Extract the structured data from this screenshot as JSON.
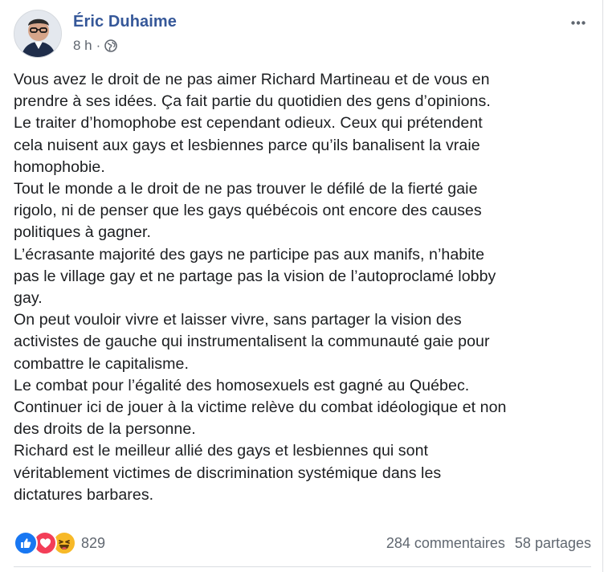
{
  "post": {
    "author": "Éric Duhaime",
    "time": "8 h",
    "separator": "·",
    "privacy_icon": "globe-icon",
    "more_icon": "more-options-icon",
    "paragraphs": [
      "Vous avez le droit de ne pas aimer Richard Martineau et de vous en prendre à ses idées. Ça fait partie du quotidien des gens d’opinions.",
      "Le traiter d’homophobe est cependant odieux. Ceux qui prétendent cela nuisent aux gays et lesbiennes parce qu’ils banalisent la vraie homophobie.",
      "Tout le monde a le droit de ne pas trouver le défilé de la fierté gaie rigolo, ni de penser que les gays québécois ont encore des causes politiques à gagner.",
      "L’écrasante majorité des gays ne participe pas aux manifs, n’habite pas le village gay et ne partage pas la vision de l’autoproclamé lobby gay.",
      "On peut vouloir vivre et laisser vivre, sans partager la vision des activistes de gauche qui instrumentalisent la communauté gaie pour combattre le capitalisme.",
      "Le combat pour l’égalité des homosexuels est gagné au Québec.",
      "Continuer ici de jouer à la victime relève du combat idéologique et non des droits de la personne.",
      "Richard est le meilleur allié des gays et lesbiennes qui sont véritablement victimes de discrimination systémique dans les dictatures barbares."
    ],
    "line_breaks": [
      "Vous avez le droit de ne pas aimer Richard Martineau et de vous en\nprendre à ses idées. Ça fait partie du quotidien des gens d’opinions.",
      "Le traiter d’homophobe est cependant odieux. Ceux qui prétendent\ncela nuisent aux gays et lesbiennes parce qu’ils banalisent la vraie\nhomophobie.",
      "Tout le monde a le droit de ne pas trouver le défilé de la fierté gaie\nrigolo, ni de penser que les gays québécois ont encore des causes\npolitiques à gagner.",
      "L’écrasante majorité des gays ne participe pas aux manifs, n’habite\npas le village gay et ne partage pas la vision de l’autoproclamé lobby\ngay.",
      "On peut vouloir vivre et laisser vivre, sans partager la vision des\nactivistes de gauche qui instrumentalisent la communauté gaie pour\ncombattre le capitalisme.",
      "Le combat pour l’égalité des homosexuels est gagné au Québec.",
      "Continuer ici de jouer à la victime relève du combat idéologique et non\ndes droits de la personne.",
      "Richard est le meilleur allié des gays et lesbiennes qui sont\nvéritablement victimes de discrimination systémique dans les\ndictatures barbares."
    ]
  },
  "footer": {
    "reaction_icons": [
      "like-icon",
      "love-icon",
      "haha-icon"
    ],
    "reaction_count": "829",
    "comments": "284 commentaires",
    "shares": "58 partages"
  },
  "colors": {
    "author_link": "#365899",
    "meta_text": "#616770",
    "like": "#1877f2",
    "love": "#f33e58",
    "haha": "#f7b928"
  }
}
